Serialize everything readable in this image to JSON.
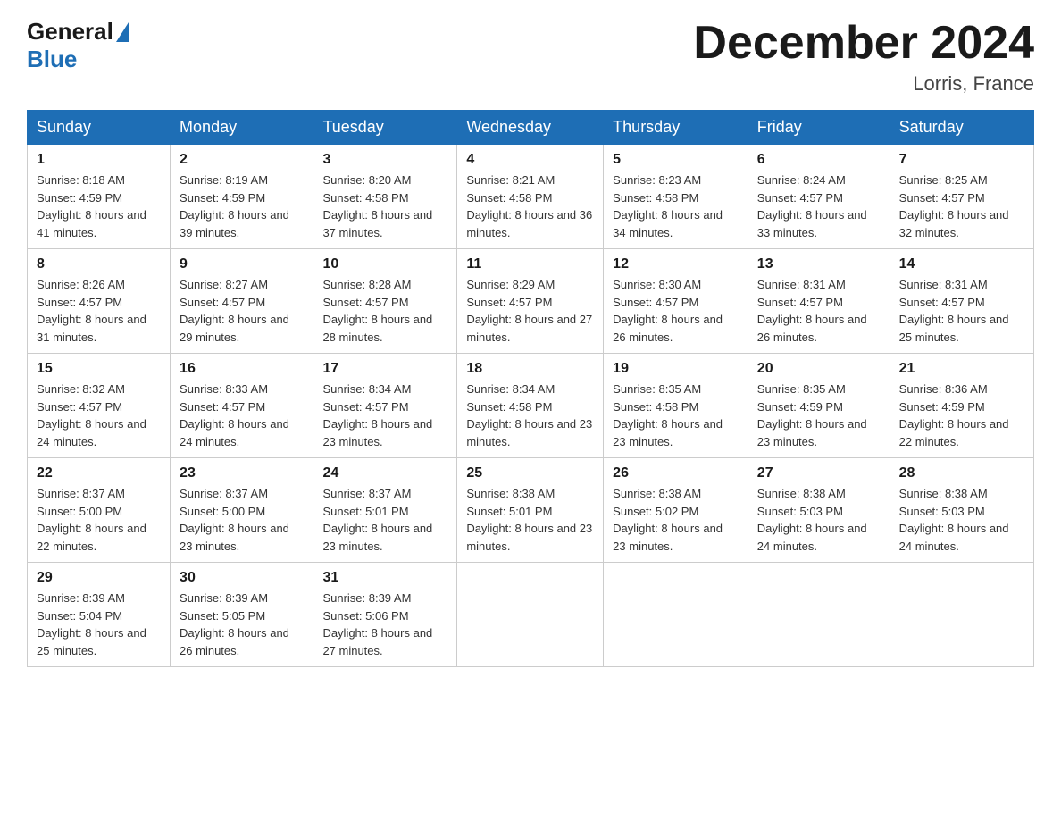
{
  "header": {
    "logo_general": "General",
    "logo_blue": "Blue",
    "title": "December 2024",
    "location": "Lorris, France"
  },
  "days_of_week": [
    "Sunday",
    "Monday",
    "Tuesday",
    "Wednesday",
    "Thursday",
    "Friday",
    "Saturday"
  ],
  "weeks": [
    [
      {
        "day": "1",
        "sunrise": "8:18 AM",
        "sunset": "4:59 PM",
        "daylight": "8 hours and 41 minutes."
      },
      {
        "day": "2",
        "sunrise": "8:19 AM",
        "sunset": "4:59 PM",
        "daylight": "8 hours and 39 minutes."
      },
      {
        "day": "3",
        "sunrise": "8:20 AM",
        "sunset": "4:58 PM",
        "daylight": "8 hours and 37 minutes."
      },
      {
        "day": "4",
        "sunrise": "8:21 AM",
        "sunset": "4:58 PM",
        "daylight": "8 hours and 36 minutes."
      },
      {
        "day": "5",
        "sunrise": "8:23 AM",
        "sunset": "4:58 PM",
        "daylight": "8 hours and 34 minutes."
      },
      {
        "day": "6",
        "sunrise": "8:24 AM",
        "sunset": "4:57 PM",
        "daylight": "8 hours and 33 minutes."
      },
      {
        "day": "7",
        "sunrise": "8:25 AM",
        "sunset": "4:57 PM",
        "daylight": "8 hours and 32 minutes."
      }
    ],
    [
      {
        "day": "8",
        "sunrise": "8:26 AM",
        "sunset": "4:57 PM",
        "daylight": "8 hours and 31 minutes."
      },
      {
        "day": "9",
        "sunrise": "8:27 AM",
        "sunset": "4:57 PM",
        "daylight": "8 hours and 29 minutes."
      },
      {
        "day": "10",
        "sunrise": "8:28 AM",
        "sunset": "4:57 PM",
        "daylight": "8 hours and 28 minutes."
      },
      {
        "day": "11",
        "sunrise": "8:29 AM",
        "sunset": "4:57 PM",
        "daylight": "8 hours and 27 minutes."
      },
      {
        "day": "12",
        "sunrise": "8:30 AM",
        "sunset": "4:57 PM",
        "daylight": "8 hours and 26 minutes."
      },
      {
        "day": "13",
        "sunrise": "8:31 AM",
        "sunset": "4:57 PM",
        "daylight": "8 hours and 26 minutes."
      },
      {
        "day": "14",
        "sunrise": "8:31 AM",
        "sunset": "4:57 PM",
        "daylight": "8 hours and 25 minutes."
      }
    ],
    [
      {
        "day": "15",
        "sunrise": "8:32 AM",
        "sunset": "4:57 PM",
        "daylight": "8 hours and 24 minutes."
      },
      {
        "day": "16",
        "sunrise": "8:33 AM",
        "sunset": "4:57 PM",
        "daylight": "8 hours and 24 minutes."
      },
      {
        "day": "17",
        "sunrise": "8:34 AM",
        "sunset": "4:57 PM",
        "daylight": "8 hours and 23 minutes."
      },
      {
        "day": "18",
        "sunrise": "8:34 AM",
        "sunset": "4:58 PM",
        "daylight": "8 hours and 23 minutes."
      },
      {
        "day": "19",
        "sunrise": "8:35 AM",
        "sunset": "4:58 PM",
        "daylight": "8 hours and 23 minutes."
      },
      {
        "day": "20",
        "sunrise": "8:35 AM",
        "sunset": "4:59 PM",
        "daylight": "8 hours and 23 minutes."
      },
      {
        "day": "21",
        "sunrise": "8:36 AM",
        "sunset": "4:59 PM",
        "daylight": "8 hours and 22 minutes."
      }
    ],
    [
      {
        "day": "22",
        "sunrise": "8:37 AM",
        "sunset": "5:00 PM",
        "daylight": "8 hours and 22 minutes."
      },
      {
        "day": "23",
        "sunrise": "8:37 AM",
        "sunset": "5:00 PM",
        "daylight": "8 hours and 23 minutes."
      },
      {
        "day": "24",
        "sunrise": "8:37 AM",
        "sunset": "5:01 PM",
        "daylight": "8 hours and 23 minutes."
      },
      {
        "day": "25",
        "sunrise": "8:38 AM",
        "sunset": "5:01 PM",
        "daylight": "8 hours and 23 minutes."
      },
      {
        "day": "26",
        "sunrise": "8:38 AM",
        "sunset": "5:02 PM",
        "daylight": "8 hours and 23 minutes."
      },
      {
        "day": "27",
        "sunrise": "8:38 AM",
        "sunset": "5:03 PM",
        "daylight": "8 hours and 24 minutes."
      },
      {
        "day": "28",
        "sunrise": "8:38 AM",
        "sunset": "5:03 PM",
        "daylight": "8 hours and 24 minutes."
      }
    ],
    [
      {
        "day": "29",
        "sunrise": "8:39 AM",
        "sunset": "5:04 PM",
        "daylight": "8 hours and 25 minutes."
      },
      {
        "day": "30",
        "sunrise": "8:39 AM",
        "sunset": "5:05 PM",
        "daylight": "8 hours and 26 minutes."
      },
      {
        "day": "31",
        "sunrise": "8:39 AM",
        "sunset": "5:06 PM",
        "daylight": "8 hours and 27 minutes."
      },
      null,
      null,
      null,
      null
    ]
  ],
  "labels": {
    "sunrise": "Sunrise:",
    "sunset": "Sunset:",
    "daylight": "Daylight:"
  }
}
